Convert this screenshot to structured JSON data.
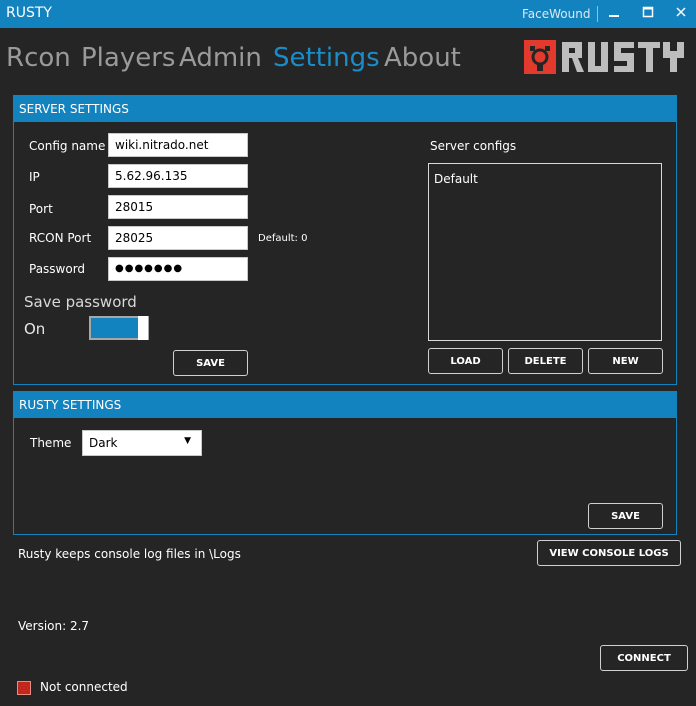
{
  "app": {
    "title": "RUSTY",
    "user": "FaceWound"
  },
  "window_controls": {
    "minimize": "▁",
    "maximize": "☐",
    "close": "✕"
  },
  "nav": {
    "tabs": [
      "Rcon",
      "Players",
      "Admin",
      "Settings",
      "About"
    ],
    "active": "Settings"
  },
  "logo": {
    "text": "RUSTY",
    "brand_color": "#e23b2e"
  },
  "server_settings": {
    "header": "SERVER SETTINGS",
    "config_name_label": "Config name",
    "config_name_value": "wiki.nitrado.net",
    "ip_label": "IP",
    "ip_value": "5.62.96.135",
    "port_label": "Port",
    "port_value": "28015",
    "rcon_port_label": "RCON Port",
    "rcon_port_value": "28025",
    "rcon_default_note": "Default: 0",
    "password_label": "Password",
    "password_value": "●●●●●●●",
    "save_password_label": "Save password",
    "toggle_state_label": "On",
    "toggle_on": true,
    "save_button": "SAVE",
    "server_configs_label": "Server configs",
    "configs": [
      "Default"
    ],
    "load_button": "LOAD",
    "delete_button": "DELETE",
    "new_button": "NEW"
  },
  "rusty_settings": {
    "header": "RUSTY SETTINGS",
    "theme_label": "Theme",
    "theme_value": "Dark",
    "save_button": "SAVE"
  },
  "logs": {
    "note": "Rusty keeps console log files in \\Logs",
    "view_button": "VIEW CONSOLE LOGS"
  },
  "footer": {
    "version": "Version: 2.7",
    "connect_button": "CONNECT",
    "status": "Not connected",
    "status_color": "#c1271d"
  },
  "colors": {
    "accent": "#1383bf",
    "background": "#252526"
  }
}
